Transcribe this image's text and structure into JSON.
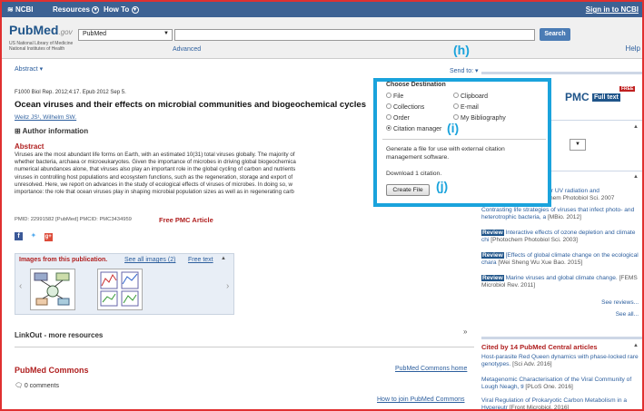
{
  "ncbi_bar": {
    "logo": "NCBI",
    "resources": "Resources",
    "howto": "How To",
    "signin": "Sign in to NCBI"
  },
  "header": {
    "logo": "PubMed",
    "logo_suffix": ".gov",
    "logo_sub1": "US National Library of Medicine",
    "logo_sub2": "National Institutes of Health",
    "database": "PubMed",
    "search_value": "",
    "search_button": "Search",
    "advanced": "Advanced",
    "help": "Help"
  },
  "article": {
    "format_tab": "Abstract",
    "send_to": "Send to:",
    "citation": "F1000 Biol Rep. 2012;4:17. Epub 2012 Sep 5.",
    "title": "Ocean viruses and their effects on microbial communities and biogeochemical cycles",
    "authors": "Weitz JS¹, Wilhelm SW.",
    "author_info": "Author information",
    "abstract_heading": "Abstract",
    "abstract_text": "Viruses are the most abundant life forms on Earth, with an estimated 10(31) total viruses globally. The majority of\nwhether bacteria, archaea or microeukaryotes. Given the importance of microbes in driving global biogeochemica\nnumerical abundances alone, that viruses also play an important role in the global cycling of carbon and nutrients\nviruses in controlling host populations and ecosystem functions, such as the regeneration, storage and export of\nunresolved. Here, we report on advances in the study of ecological effects of viruses of microbes. In doing so, w\nimportance: the role that ocean viruses play in shaping microbial population sizes as well as in regenerating carb",
    "pmid": "PMID: 22991582 [PubMed]   PMCID: PMC3434959",
    "free_pmc": "Free PMC Article"
  },
  "images": {
    "heading": "Images from this publication.",
    "see_all": "See all images (2)",
    "free_text": "Free text"
  },
  "linkout": "LinkOut - more resources",
  "commons": {
    "heading": "PubMed Commons",
    "home": "PubMed Commons home",
    "comments": "0 comments",
    "join": "How to join PubMed Commons"
  },
  "popup": {
    "heading": "Choose Destination",
    "options": [
      "File",
      "Clipboard",
      "Collections",
      "E-mail",
      "Order",
      "My Bibliography",
      "Citation manager"
    ],
    "selected": "Citation manager",
    "description": "Generate a file for use with external citation management software.",
    "download": "Download 1 citation.",
    "create_button": "Create File"
  },
  "callouts": {
    "h": "(h)",
    "i": "(i)",
    "j": "(j)"
  },
  "right_column": {
    "similar_items": [
      {
        "title_line1": "olar UV radiation and",
        "src": "ochem Photobiol Sci. 2007"
      },
      {
        "title": "Contrasting life strategies of viruses that infect photo- and heterotrophic bacteria, a",
        "src": "[MBio. 2012]"
      },
      {
        "badge": "Review",
        "title": "Interactive effects of ozone depletion and climate chi",
        "src": "[Photochem Photobiol Sci. 2003]"
      },
      {
        "badge": "Review",
        "title": "[Effects of global climate change on the ecological chara",
        "src": "[Wei Sheng Wu Xue Bao. 2015]"
      },
      {
        "badge": "Review",
        "title": "Marine viruses and global climate change.",
        "src": "[FEMS Microbiol Rev. 2011]"
      }
    ],
    "see_reviews": "See reviews...",
    "see_all": "See all...",
    "cited_heading": "Cited by 14 PubMed Central articles",
    "cited": [
      {
        "title": "Host-parasite Red Queen dynamics with phase-locked rare genotypes.",
        "src": "[Sci Adv. 2016]"
      },
      {
        "title": "Metagenomic Characterisation of the Viral Community of Lough Neagh, tł",
        "src": "[PLoS One. 2016]"
      },
      {
        "title": "Viral Regulation of Prokaryotic Carbon Metabolism in a Hypereutr",
        "src": "[Front Microbiol. 2016]"
      }
    ]
  }
}
